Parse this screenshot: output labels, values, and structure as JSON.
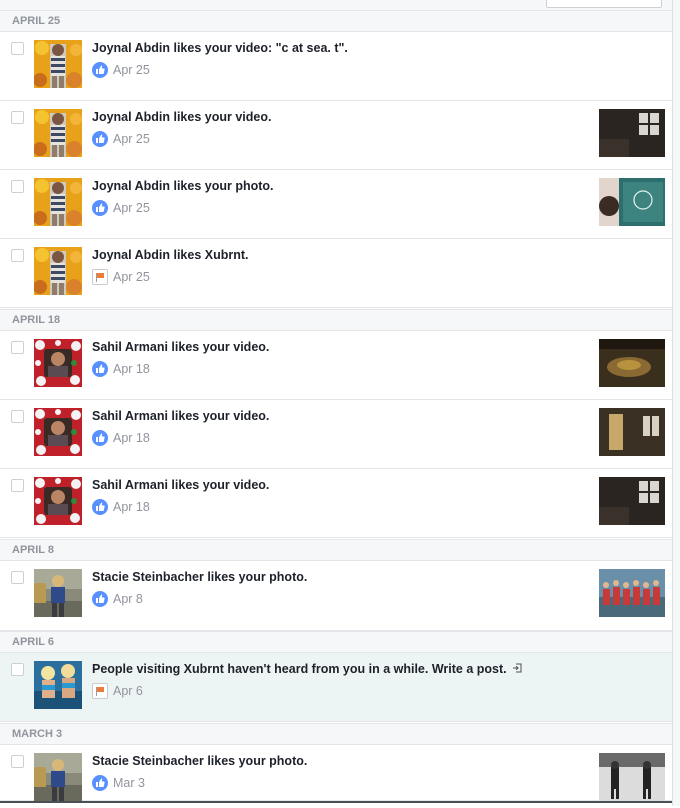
{
  "sections": [
    {
      "header": "APRIL 25",
      "items": [
        {
          "text": "Joynal Abdin likes your video: \"c at sea. t\".",
          "date": "Apr 25",
          "icon": "like-icon",
          "avatar": "joynal",
          "thumb": null
        },
        {
          "text": "Joynal Abdin likes your video.",
          "date": "Apr 25",
          "icon": "like-icon",
          "avatar": "joynal",
          "thumb": "dark-window"
        },
        {
          "text": "Joynal Abdin likes your photo.",
          "date": "Apr 25",
          "icon": "like-icon",
          "avatar": "joynal",
          "thumb": "teal-sign"
        },
        {
          "text": "Joynal Abdin likes Xubrnt.",
          "date": "Apr 25",
          "icon": "page-flag-icon",
          "avatar": "joynal",
          "thumb": null
        }
      ]
    },
    {
      "header": "APRIL 18",
      "items": [
        {
          "text": "Sahil Armani likes your video.",
          "date": "Apr 18",
          "icon": "like-icon",
          "avatar": "sahil",
          "thumb": "brown-dark"
        },
        {
          "text": "Sahil Armani likes your video.",
          "date": "Apr 18",
          "icon": "like-icon",
          "avatar": "sahil",
          "thumb": "dark-doorway"
        },
        {
          "text": "Sahil Armani likes your video.",
          "date": "Apr 18",
          "icon": "like-icon",
          "avatar": "sahil",
          "thumb": "dark-window"
        }
      ]
    },
    {
      "header": "APRIL 8",
      "items": [
        {
          "text": "Stacie Steinbacher likes your photo.",
          "date": "Apr 8",
          "icon": "like-icon",
          "avatar": "stacie",
          "thumb": "group-red"
        }
      ]
    },
    {
      "header": "APRIL 6",
      "items": [
        {
          "text": "People visiting Xubrnt haven't heard from you in a while. Write a post.",
          "date": "Apr 6",
          "icon": "page-flag-icon",
          "avatar": "blue-pic",
          "thumb": null,
          "highlight": true,
          "external": true
        }
      ]
    },
    {
      "header": "MARCH 3",
      "items": [
        {
          "text": "Stacie Steinbacher likes your photo.",
          "date": "Mar 3",
          "icon": "like-icon",
          "avatar": "stacie",
          "thumb": "bw-runners"
        }
      ]
    }
  ],
  "colors": {
    "like_blue": "#5890ff",
    "header_bg": "#f6f7f9",
    "header_text": "#90949c",
    "highlight_bg": "#edf4f4"
  }
}
